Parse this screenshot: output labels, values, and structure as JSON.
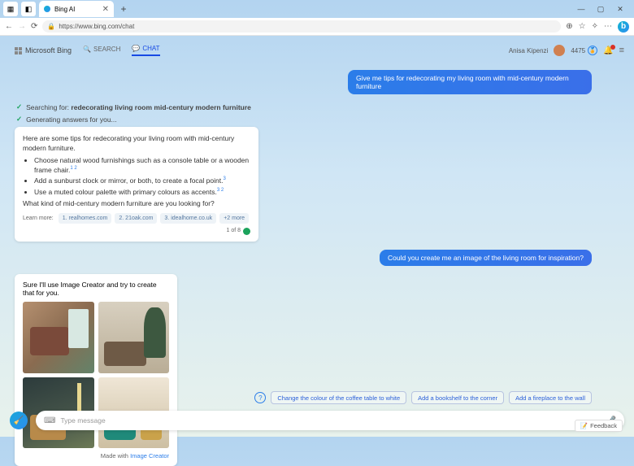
{
  "browser": {
    "tab_title": "Bing AI",
    "url": "https://www.bing.com/chat",
    "window_minimize": "—",
    "window_maximize": "▢",
    "window_close": "✕"
  },
  "header": {
    "logo_text": "Microsoft Bing",
    "tab_search": "SEARCH",
    "tab_chat": "CHAT",
    "user_name": "Anisa Kipenzi",
    "points": "4475"
  },
  "chat": {
    "user1": "Give me tips for redecorating my living room with mid-century modern furniture",
    "status_search_prefix": "Searching for: ",
    "status_search_query": "redecorating living room mid-century modern furniture",
    "status_generate": "Generating answers for you...",
    "ai1_intro": "Here are some tips for redecorating your living room with mid-century modern furniture.",
    "ai1_li1": "Choose natural wood furnishings such as a console table or a wooden frame chair.",
    "ai1_li2": "Add a sunburst clock or mirror, or both, to create a focal point.",
    "ai1_li3": "Use a muted colour palette with primary colours as accents.",
    "ai1_followup": "What kind of mid-century modern furniture are you looking for?",
    "learn_label": "Learn more:",
    "src1": "1. realhomes.com",
    "src2": "2. 21oak.com",
    "src3": "3. idealhome.co.uk",
    "src_more": "+2 more",
    "count": "1 of 8",
    "user2": "Could you create me an image of the living room for inspiration?",
    "ai2_text": "Sure I'll use Image Creator and try to create that for you.",
    "made_prefix": "Made with ",
    "made_link": "Image Creator"
  },
  "suggestions": {
    "s1": "Change the colour of the coffee table to white",
    "s2": "Add a bookshelf to the corner",
    "s3": "Add a fireplace to the wall"
  },
  "input": {
    "placeholder": "Type message"
  },
  "feedback": {
    "label": "Feedback"
  }
}
